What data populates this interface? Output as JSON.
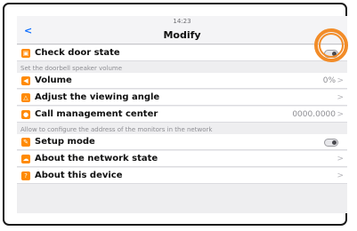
{
  "status": {
    "time": "14:23"
  },
  "nav": {
    "back": "<",
    "title": "Modify"
  },
  "rows": {
    "check_door": {
      "label": "Check door state",
      "icon": "door-icon"
    },
    "volume": {
      "label": "Volume",
      "value": "0%",
      "icon": "speaker-icon"
    },
    "viewing_angle": {
      "label": "Adjust the viewing angle",
      "icon": "triangle-icon"
    },
    "call_center": {
      "label": "Call management center",
      "value": "0000.0000",
      "icon": "person-icon"
    },
    "setup_mode": {
      "label": "Setup mode",
      "icon": "wrench-icon"
    },
    "network_state": {
      "label": "About the network state",
      "icon": "cloud-icon"
    },
    "about_device": {
      "label": "About this device",
      "icon": "question-icon"
    }
  },
  "sections": {
    "speaker": "Set the doorbell speaker volume",
    "network": "Allow to configure the address of the monitors in the network"
  },
  "chevron": ">",
  "colors": {
    "accent": "#ff8a00",
    "highlight": "#f28c28",
    "link": "#0a6cff"
  }
}
